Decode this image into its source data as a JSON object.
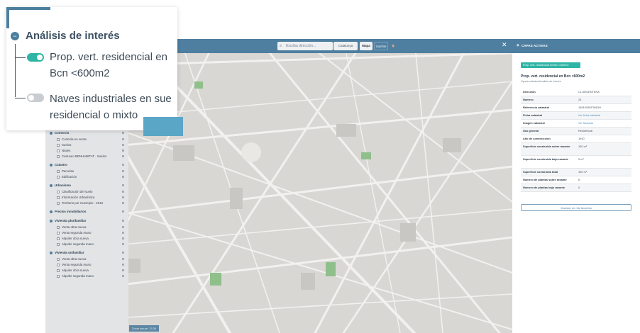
{
  "popup": {
    "title": "Análisis de interés",
    "items": [
      {
        "label_line1": "Prop. vert. residencial en",
        "label_line2": "Bcn <600m2",
        "enabled": true
      },
      {
        "label_line1": "Naves industriales en sue",
        "label_line2": "residencial o mixto",
        "enabled": false
      }
    ]
  },
  "toolbar": {
    "search_placeholder": "Escriba dirección...",
    "category": "Catalunya",
    "map_btn": "Mapa",
    "sat_btn": "Satélite"
  },
  "map": {
    "scale_label": "Zoom actual: 13.35"
  },
  "layers_panel": {
    "groups": [
      {
        "name": "Comercio",
        "items": [
          "Cortesía en venta",
          "Suelos",
          "Naves",
          "Cartuxeo BENHABITAT · Suelos"
        ]
      },
      {
        "name": "Catastro",
        "items": [
          "Parcelas",
          "Edificación"
        ]
      },
      {
        "name": "Urbanismo",
        "items": [
          "Clasificación del suelo",
          "Información Urbanística",
          "Territorio por municipio · 2013"
        ]
      },
      {
        "name": "Precios inmobiliarios",
        "items": []
      },
      {
        "name": "Vivienda plurifamiliar",
        "items": [
          "Venta obra nueva",
          "Venta segunda mano",
          "Alquiler obra nueva",
          "Alquiler segunda mano"
        ]
      },
      {
        "name": "Vivienda unifamiliar",
        "items": [
          "Venta obra nueva",
          "Venta segunda mano",
          "Alquiler obra nueva",
          "Alquiler segunda mano"
        ]
      }
    ]
  },
  "right_panel": {
    "header": "CAPAS ACTIVAS",
    "badge": "Prop. vert. residencial en Bcn <600m2",
    "title": "Prop. vert. residencial en Bcn <600m2",
    "subtitle": "Oportunidades/Análisis de interés",
    "rows": [
      {
        "key": "Dirección",
        "value": "CL ARGENTERA",
        "link": false
      },
      {
        "key": "Número",
        "value": "23",
        "link": false
      },
      {
        "key": "Referencia catastral",
        "value": "1581903DF3815H",
        "link": false
      },
      {
        "key": "Ficha catastral",
        "value": "Ver ficha catastral",
        "link": true
      },
      {
        "key": "Imagen catastral",
        "value": "Ver fachada",
        "link": true
      },
      {
        "key": "Uso general",
        "value": "Residencial",
        "link": false
      },
      {
        "key": "Año de construcción",
        "value": "1940",
        "link": false
      },
      {
        "key": "Superficie construida sobre rasante",
        "value": "150 m²",
        "link": false
      },
      {
        "key": "Superficie construida bajo rasante",
        "value": "0 m²",
        "link": false
      },
      {
        "key": "Superficie construida total",
        "value": "150 m²",
        "link": false
      },
      {
        "key": "Número de plantas sobre rasante",
        "value": "6",
        "link": false
      },
      {
        "key": "Número de plantas bajo rasante",
        "value": "0",
        "link": false
      }
    ],
    "save_btn": "Guardar en mis favoritos"
  },
  "colors": {
    "accent": "#4f7fa0",
    "teal": "#2eb5a5",
    "map_bg": "#d9d7d4"
  }
}
